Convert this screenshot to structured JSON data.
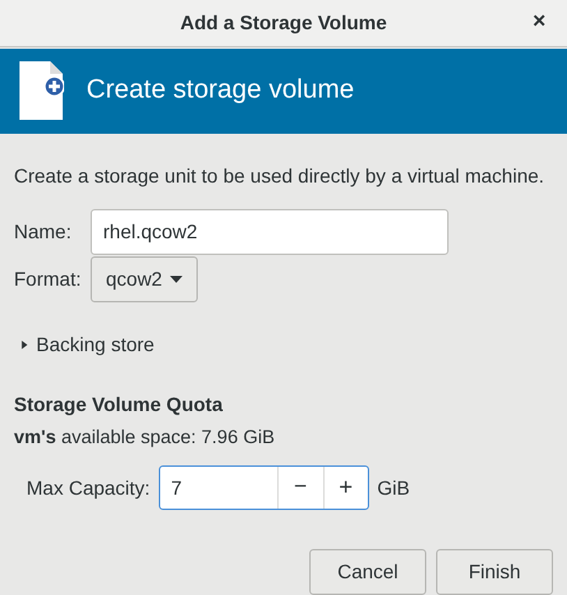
{
  "window": {
    "title": "Add a Storage Volume",
    "close": "×"
  },
  "banner": {
    "title": "Create storage volume"
  },
  "description": "Create a storage unit to be used directly by a virtual machine.",
  "name_field": {
    "label": "Name:",
    "value": "rhel.qcow2"
  },
  "format": {
    "label": "Format:",
    "value": "qcow2"
  },
  "backing_store": {
    "label": "Backing store",
    "expanded": false
  },
  "quota": {
    "heading": "Storage Volume Quota",
    "available": "**vm's** available space: 7.96 GiB",
    "capacity_label": "Max Capacity:",
    "capacity_value": "7",
    "decrement": "−",
    "increment": "+",
    "unit": "GiB"
  },
  "buttons": [
    {
      "label": "Cancel"
    },
    {
      "label": "Finish"
    }
  ]
}
